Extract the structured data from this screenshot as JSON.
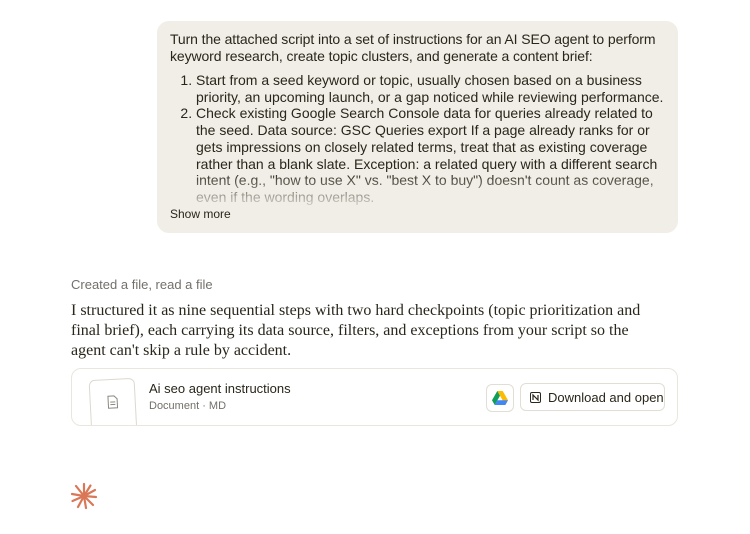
{
  "user_message": {
    "intro": "Turn the attached script into a set of instructions for an AI SEO agent to perform keyword research, create topic clusters, and generate a content brief:",
    "steps": [
      "Start from a seed keyword or topic, usually chosen based on a business priority, an upcoming launch, or a gap noticed while reviewing performance.",
      "Check existing Google Search Console data for queries already related to the seed. Data source: GSC Queries export If a page already ranks for or gets impressions on closely related terms, treat that as existing coverage rather than a blank slate. Exception: a related query with a different search intent (e.g., \"how to use X\" vs. \"best X to buy\") doesn't count as coverage, even if the wording overlaps."
    ],
    "show_more_label": "Show more"
  },
  "tool_status": "Created a file, read a file",
  "assistant_message": "I structured it as nine sequential steps with two hard checkpoints (topic prioritization and final brief), each carrying its data source, filters, and exceptions from your script so the agent can't skip a rule by accident.",
  "file_card": {
    "name": "Ai seo agent instructions",
    "meta": "Document · MD",
    "download_label": "Download and open",
    "icons": {
      "thumb": "document-icon",
      "drive": "google-drive-icon",
      "notion": "notion-icon"
    }
  },
  "colors": {
    "bubble_bg": "#f0eee6",
    "text": "#29261b",
    "muted": "#73706a",
    "brand_spark": "#d97757"
  }
}
